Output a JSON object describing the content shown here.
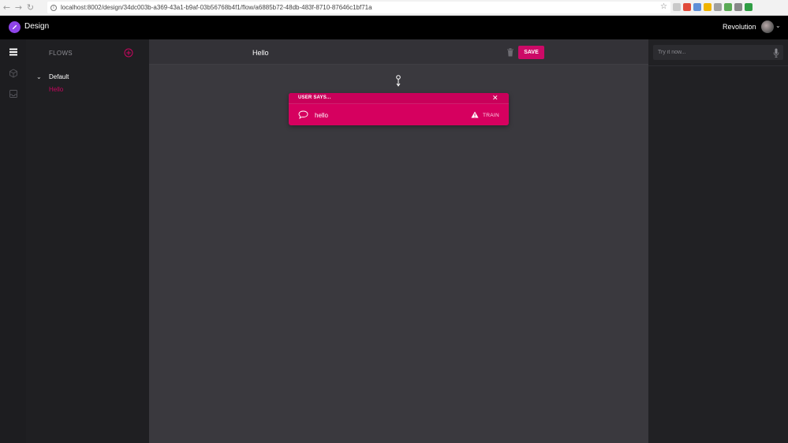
{
  "browser": {
    "back": "←",
    "forward": "→",
    "reload": "↻",
    "url": "localhost:8002/design/34dc003b-a369-43a1-b9af-03b56768b4f1/flow/a6885b72-48db-483f-8710-87646c1bf71a",
    "extension_colors": [
      "#c9c9c9",
      "#e04a3a",
      "#5f8fd8",
      "#f0b400",
      "#a0a0a0",
      "#5aaa55",
      "#888888",
      "#2f9e44"
    ]
  },
  "header": {
    "app_title": "Design",
    "workspace_name": "Revolution",
    "caret": "⌄"
  },
  "flows": {
    "title": "FLOWS",
    "tree_caret": "⌄",
    "group_label": "Default",
    "item_label": "Hello"
  },
  "canvas": {
    "flow_title": "Hello",
    "save_label": "SAVE",
    "card": {
      "title": "USER SAYS...",
      "close": "✕",
      "utterance": "hello",
      "train_label": "TRAIN"
    }
  },
  "tester": {
    "placeholder": "Try it now..."
  },
  "colors": {
    "accent": "#d6005f",
    "logo": "#8e44e8",
    "header": "#000000",
    "canvas": "#3a393e"
  }
}
